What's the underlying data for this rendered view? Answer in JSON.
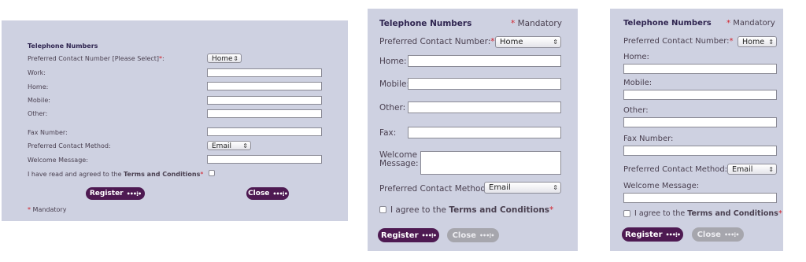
{
  "panel1": {
    "title": "Telephone Numbers",
    "preferred_contact_label": "Preferred Contact Number [Please Select]",
    "asterisk": "*",
    "colon": ":",
    "preferred_contact_value": "Home",
    "work_label": "Work:",
    "home_label": "Home:",
    "mobile_label": "Mobile:",
    "other_label": "Other:",
    "fax_label": "Fax Number:",
    "contact_method_label": "Preferred Contact Method:",
    "contact_method_value": "Email",
    "welcome_label": "Welcome Message:",
    "agree_prefix": "I have read and agreed to the ",
    "agree_link": "Terms and Conditions",
    "register_label": "Register",
    "close_label": "Close",
    "mandatory_note": "Mandatory"
  },
  "panel2": {
    "title": "Telephone Numbers",
    "mandatory_note": "Mandatory",
    "preferred_contact_label": "Preferred Contact Number:",
    "preferred_contact_value": "Home",
    "home_label": "Home:",
    "mobile_label": "Mobile:",
    "other_label": "Other:",
    "fax_label": "Fax:",
    "welcome_label_line1": "Welcome",
    "welcome_label_line2": "Message:",
    "contact_method_label": "Preferred Contact Method:",
    "contact_method_value": "Email",
    "agree_prefix": "I agree to the ",
    "agree_link": "Terms and Conditions",
    "register_label": "Register",
    "close_label": "Close"
  },
  "panel3": {
    "title": "Telephone Numbers",
    "mandatory_note": "Mandatory",
    "preferred_contact_label": "Preferred Contact Number:",
    "preferred_contact_value": "Home",
    "home_label": "Home:",
    "mobile_label": "Mobile:",
    "other_label": "Other:",
    "fax_label": "Fax Number:",
    "contact_method_label": "Preferred Contact Method:",
    "contact_method_value": "Email",
    "welcome_label": "Welcome Message:",
    "agree_prefix": "I agree to the ",
    "agree_link": "Terms and Conditions",
    "register_label": "Register",
    "close_label": "Close"
  },
  "common": {
    "asterisk": "*",
    "dots": "•••⁞•",
    "select_arrow": "⇕"
  },
  "colors": {
    "panel_bg": "#ced1e1",
    "button_active": "#4e1a52",
    "button_disabled": "#a6a6ad",
    "mandatory_star": "#d2202a"
  }
}
